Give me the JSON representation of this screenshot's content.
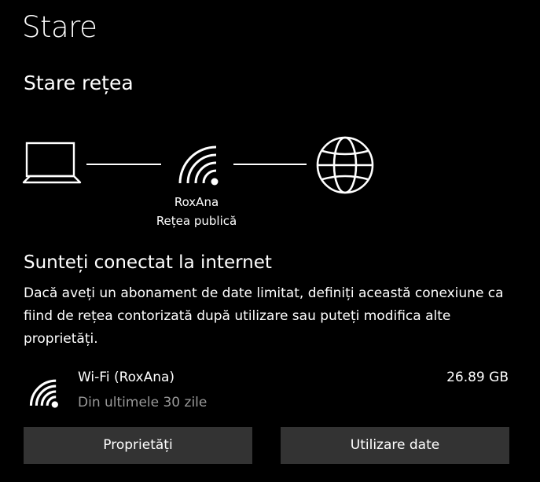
{
  "page": {
    "title": "Stare"
  },
  "network_status": {
    "section_title": "Stare rețea",
    "diagram": {
      "device_icon": "laptop-icon",
      "network_icon": "wifi-icon",
      "internet_icon": "globe-icon",
      "network_name": "RoxAna",
      "network_type": "Rețea publică"
    },
    "heading": "Sunteți conectat la internet",
    "description": "Dacă aveți un abonament de date limitat, definiți această conexiune ca fiind de rețea contorizată după utilizare sau puteți modifica alte proprietăți."
  },
  "connection": {
    "icon": "wifi-icon",
    "name": "Wi-Fi (RoxAna)",
    "period": "Din ultimele 30 zile",
    "usage": "26.89 GB"
  },
  "buttons": {
    "properties_label": "Proprietăți",
    "data_usage_label": "Utilizare date"
  },
  "colors": {
    "background": "#000000",
    "text": "#ffffff",
    "secondary_text": "#9a9a9a",
    "button_background": "#333333"
  }
}
